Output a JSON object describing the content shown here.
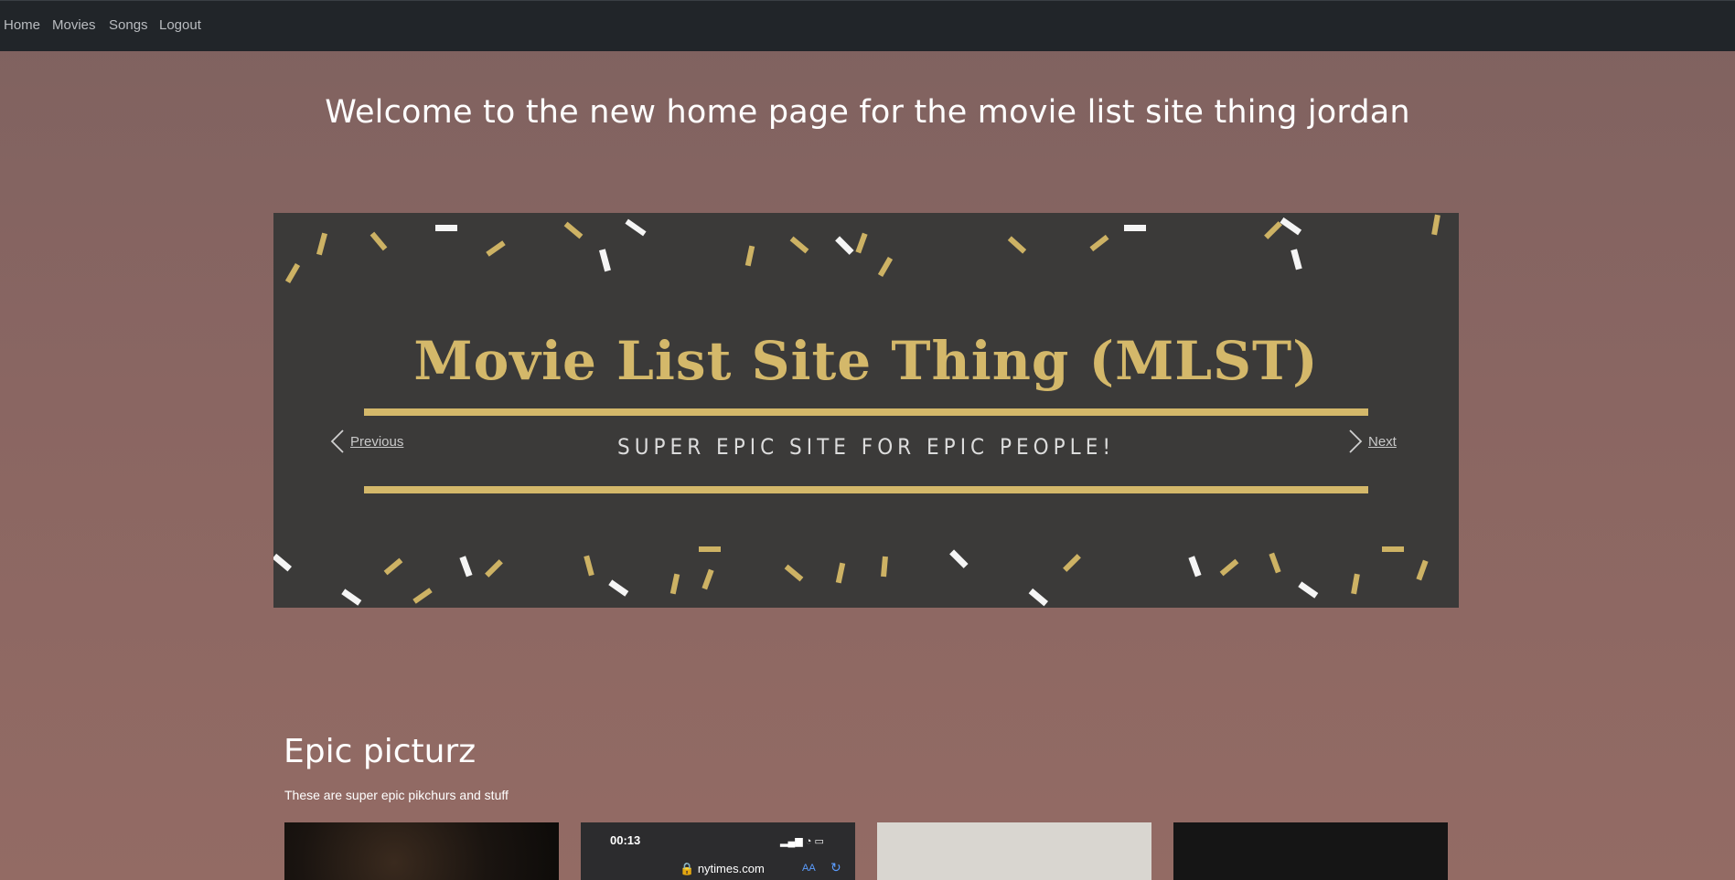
{
  "nav": {
    "items": [
      {
        "label": "Home"
      },
      {
        "label": "Movies"
      },
      {
        "label": "Songs"
      },
      {
        "label": "Logout"
      }
    ]
  },
  "page": {
    "title": "Welcome to the new home page for the movie list site thing jordan"
  },
  "carousel": {
    "slide_title": "Movie List Site Thing (MLST)",
    "slide_subtitle": "SUPER EPIC SITE FOR EPIC PEOPLE!",
    "prev_label": "Previous",
    "next_label": "Next",
    "colors": {
      "background": "#3b3a39",
      "gold": "#d4b86a"
    }
  },
  "gallery": {
    "title": "Epic picturz",
    "subtitle": "These are super epic pikchurs and stuff",
    "thumb2": {
      "time": "00:13",
      "url": "nytimes.com",
      "aa": "AA"
    }
  },
  "colors": {
    "navbar": "#212529",
    "page_bg": "#8a6662"
  }
}
